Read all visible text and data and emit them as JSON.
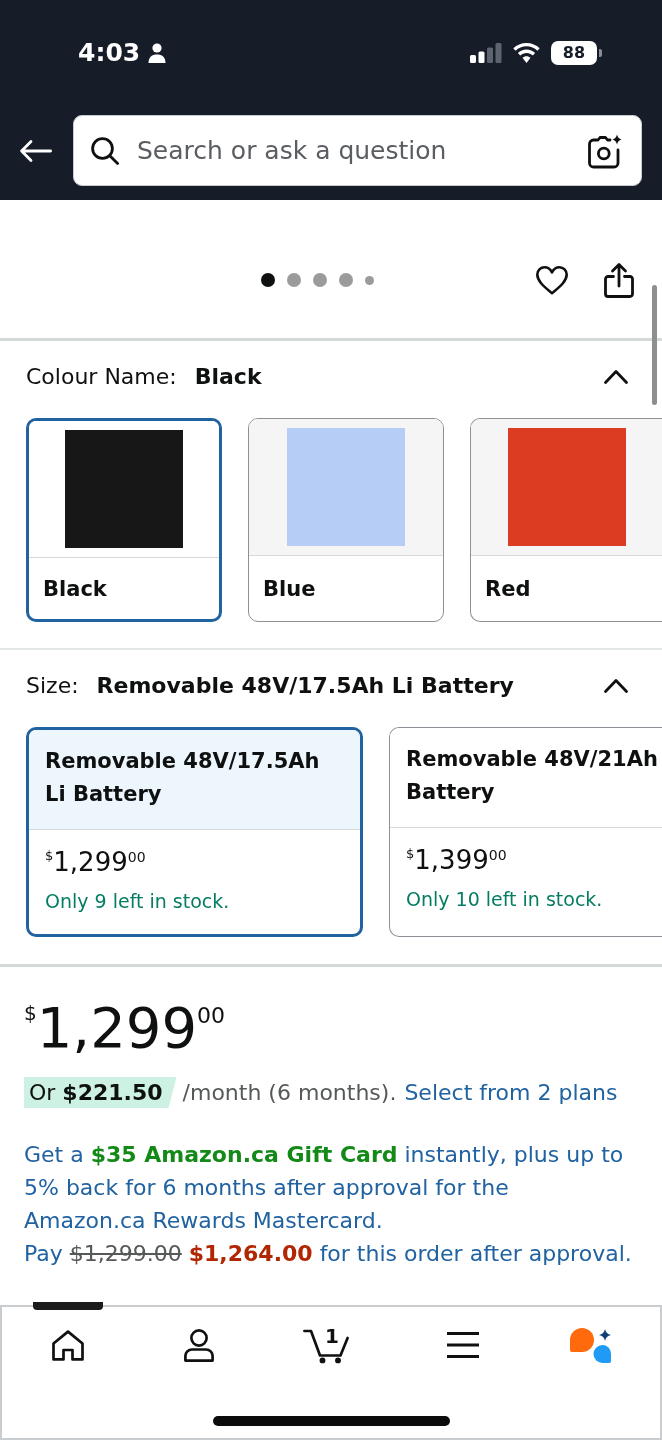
{
  "status_bar": {
    "time": "4:03",
    "battery": "88"
  },
  "search": {
    "placeholder": "Search or ask a question"
  },
  "gallery": {
    "dots": [
      {
        "selected": true
      },
      {
        "selected": false
      },
      {
        "selected": false
      },
      {
        "selected": false
      },
      {
        "selected": false
      }
    ]
  },
  "variations": [
    {
      "kind": "colour",
      "label": "Colour Name:",
      "value": "Black",
      "expanded": true,
      "options": [
        {
          "label": "Black",
          "color": "#171717",
          "selected": true
        },
        {
          "label": "Blue",
          "color": "#b6cdf5",
          "selected": false
        },
        {
          "label": "Red",
          "color": "#dc3d22",
          "selected": false
        }
      ]
    },
    {
      "kind": "size",
      "label": "Size:",
      "value": "Removable 48V/17.5Ah Li Battery",
      "expanded": true,
      "options": [
        {
          "title": "Removable 48V/17.5Ah Li Battery",
          "price": {
            "symbol": "$",
            "whole": "1,299",
            "fraction": "00"
          },
          "stock": "Only 9 left in stock.",
          "selected": true
        },
        {
          "title": "Removable 48V/21Ah Battery",
          "price": {
            "symbol": "$",
            "whole": "1,399",
            "fraction": "00"
          },
          "stock": "Only 10 left in stock.",
          "selected": false
        }
      ]
    }
  ],
  "price": {
    "symbol": "$",
    "whole": "1,299",
    "fraction": "00"
  },
  "installment": {
    "badge": "Or **$221.50**",
    "text": "/month (6 months).",
    "link": "Select from 2 plans"
  },
  "card_offer": {
    "text": "Get a **$35 Amazon.ca Gift Card** instantly, plus up to 5% back for 6 months after approval for the Amazon.ca Rewards Mastercard.",
    "pay": {
      "lead": "Pay",
      "old_price": "$1,299.00",
      "new_price": "$1,264.00",
      "tail": "for this order after approval."
    }
  },
  "nav": {
    "items": [
      {
        "kind": "home",
        "selected": true
      },
      {
        "kind": "account",
        "selected": false
      },
      {
        "kind": "cart",
        "selected": false,
        "count": "1"
      },
      {
        "kind": "menu",
        "selected": false
      },
      {
        "kind": "assistant",
        "selected": false
      }
    ]
  }
}
